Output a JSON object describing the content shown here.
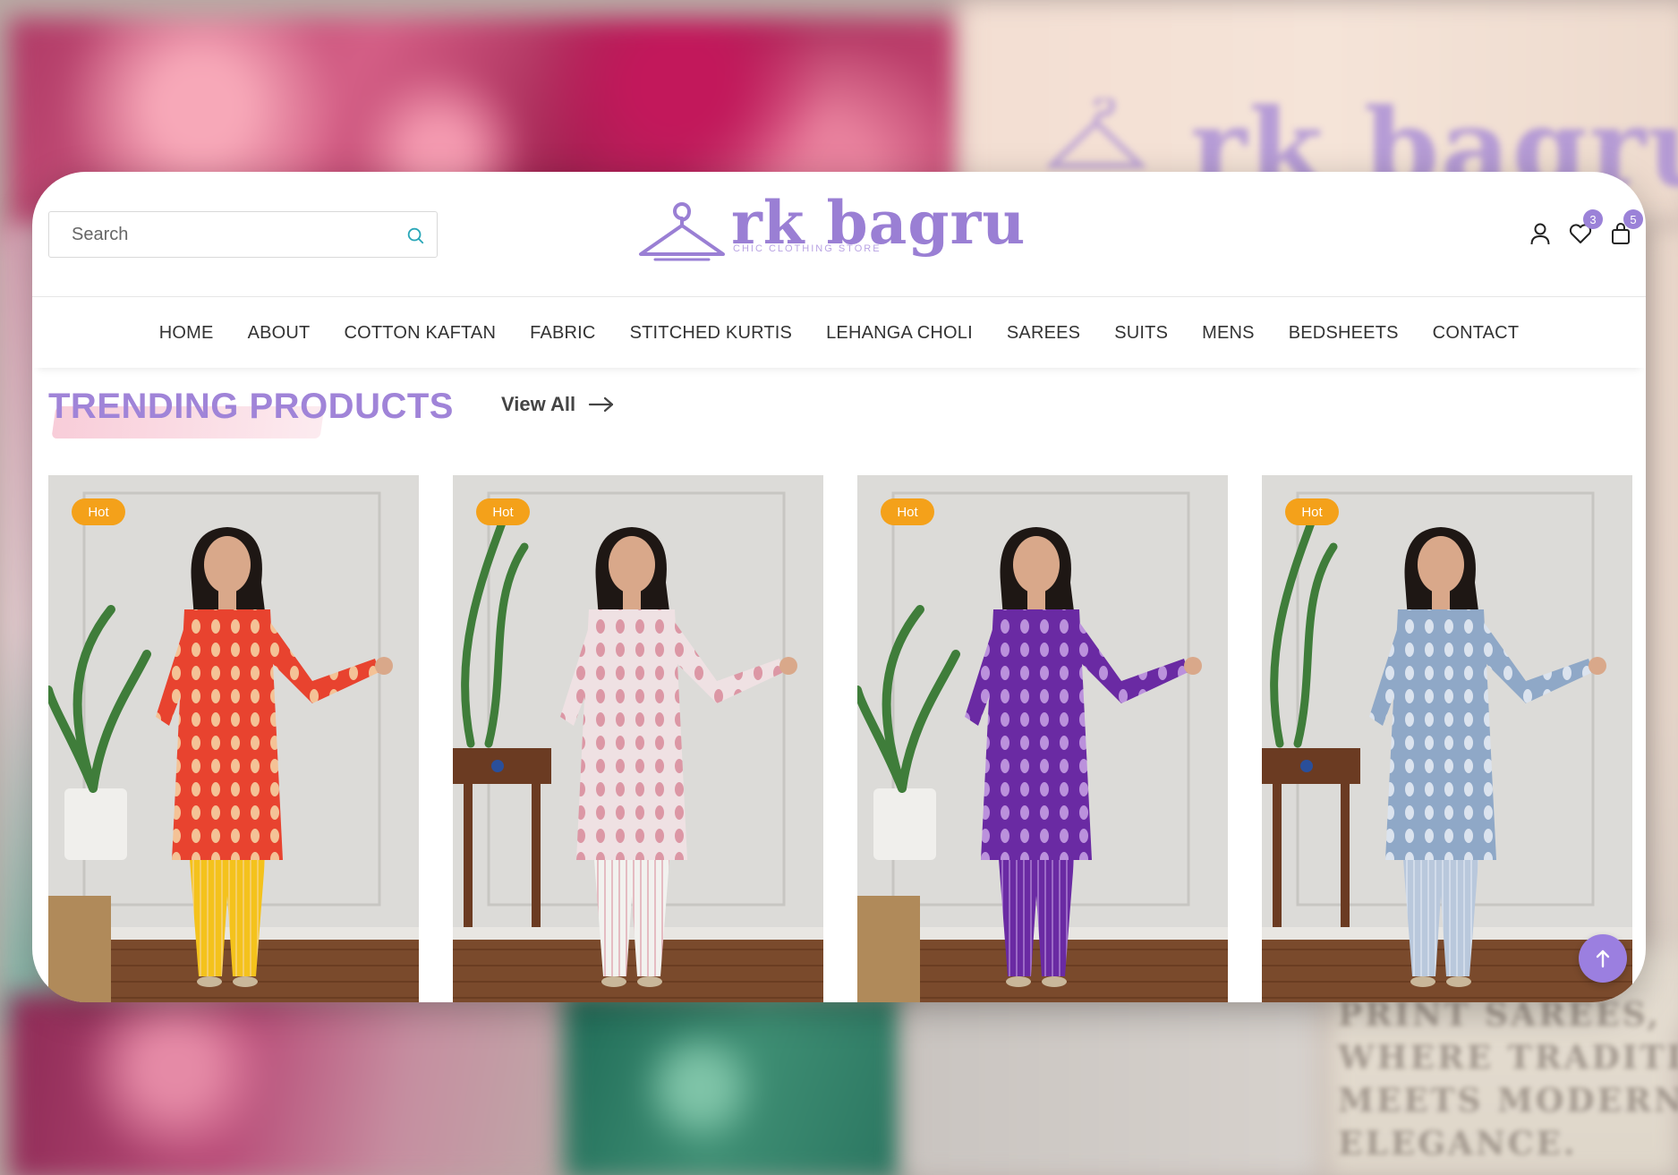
{
  "brand": {
    "name": "rk bagru",
    "tagline": "CHIC CLOTHING STORE",
    "accent_color": "#9a7fd4",
    "badge_color": "#f4a11a"
  },
  "search": {
    "placeholder": "Search",
    "icon": "search-icon"
  },
  "header_icons": {
    "account": {
      "icon": "user-icon"
    },
    "wishlist": {
      "icon": "heart-icon",
      "count": "3"
    },
    "cart": {
      "icon": "shopping-bag-icon",
      "count": "5"
    }
  },
  "nav": {
    "items": [
      {
        "label": "HOME"
      },
      {
        "label": "ABOUT"
      },
      {
        "label": "COTTON KAFTAN"
      },
      {
        "label": "FABRIC"
      },
      {
        "label": "STITCHED KURTIS"
      },
      {
        "label": "LEHANGA CHOLI"
      },
      {
        "label": "SAREES"
      },
      {
        "label": "SUITS"
      },
      {
        "label": "MENS"
      },
      {
        "label": "BEDSHEETS"
      },
      {
        "label": "CONTACT"
      }
    ]
  },
  "section": {
    "title": "TRENDING PRODUCTS",
    "view_all": "View All"
  },
  "products": [
    {
      "badge": "Hot",
      "kurta_color": "#e8432f",
      "pant_color": "#f4c21c",
      "pattern_color": "#f6d9a8"
    },
    {
      "badge": "Hot",
      "kurta_color": "#efe1e3",
      "pant_color": "#f2f2ef",
      "pattern_color": "#d98a9a"
    },
    {
      "badge": "Hot",
      "kurta_color": "#6a2aa3",
      "pant_color": "#6a2aa3",
      "pattern_color": "#c9a4e6"
    },
    {
      "badge": "Hot",
      "kurta_color": "#8fa8c7",
      "pant_color": "#b9c8dc",
      "pattern_color": "#e9eef5"
    }
  ],
  "back_to_top": {
    "icon": "arrow-up-icon"
  },
  "background": {
    "ghost_logo": "rk bagru",
    "ghost_text": [
      "PRINT SAREES,",
      "WHERE TRADITION",
      "MEETS MODERN",
      "ELEGANCE."
    ]
  }
}
